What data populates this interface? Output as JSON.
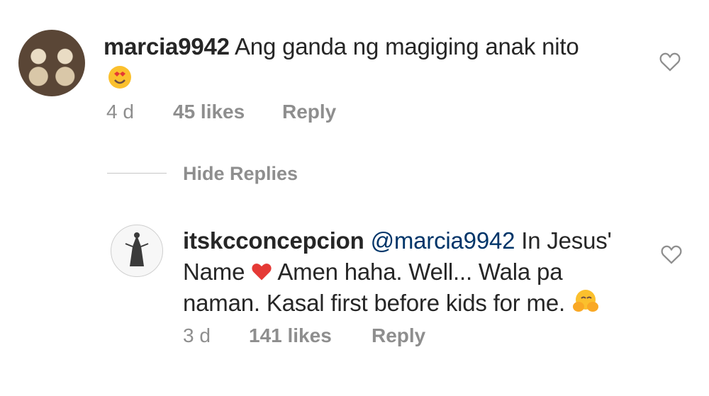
{
  "comment": {
    "username": "marcia9942",
    "text": "Ang ganda ng magiging anak nito",
    "emoji": "smiling-face-with-heart-eyes",
    "time": "4 d",
    "likes": "45 likes",
    "reply_label": "Reply"
  },
  "replies_toggle": {
    "label": "Hide Replies"
  },
  "reply": {
    "username": "itskcconcepcion",
    "mention": "@marcia9942",
    "line1_tail": "In Jesus'",
    "line2_start": "Name",
    "heart_emoji": "red-heart",
    "line2_end": "Amen haha. Well... Wala pa",
    "line3": "naman. Kasal first before kids for me.",
    "end_emoji": "hands-face",
    "time": "3 d",
    "likes": "141 likes",
    "reply_label": "Reply"
  },
  "colors": {
    "text": "#262626",
    "muted": "#8e8e8e",
    "mention": "#003569",
    "heart": "#ed4956"
  }
}
